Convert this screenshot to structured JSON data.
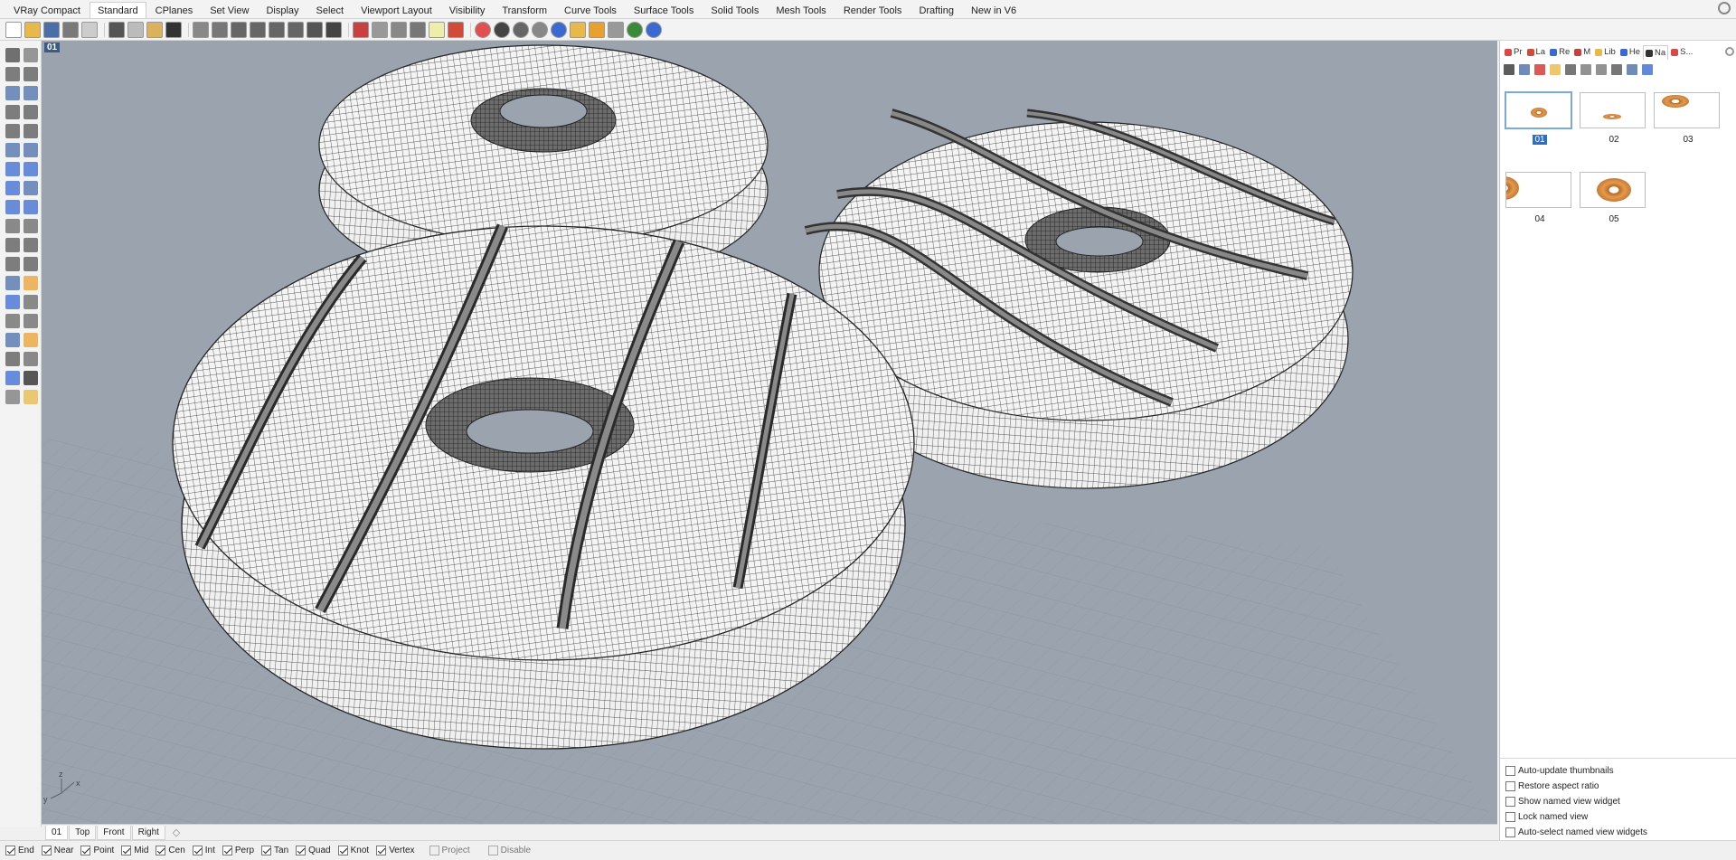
{
  "toolbar_tabs": [
    {
      "label": "VRay Compact",
      "active": false
    },
    {
      "label": "Standard",
      "active": true
    },
    {
      "label": "CPlanes",
      "active": false
    },
    {
      "label": "Set View",
      "active": false
    },
    {
      "label": "Display",
      "active": false
    },
    {
      "label": "Select",
      "active": false
    },
    {
      "label": "Viewport Layout",
      "active": false
    },
    {
      "label": "Visibility",
      "active": false
    },
    {
      "label": "Transform",
      "active": false
    },
    {
      "label": "Curve Tools",
      "active": false
    },
    {
      "label": "Surface Tools",
      "active": false
    },
    {
      "label": "Solid Tools",
      "active": false
    },
    {
      "label": "Mesh Tools",
      "active": false
    },
    {
      "label": "Render Tools",
      "active": false
    },
    {
      "label": "Drafting",
      "active": false
    },
    {
      "label": "New in V6",
      "active": false
    }
  ],
  "icon_toolbar": [
    {
      "name": "new-file-icon",
      "color": "#ffffff"
    },
    {
      "name": "open-folder-icon",
      "color": "#e8b84a"
    },
    {
      "name": "save-icon",
      "color": "#4a6ea8"
    },
    {
      "name": "print-icon",
      "color": "#7a7a7a"
    },
    {
      "name": "import-icon",
      "color": "#cccccc"
    },
    {
      "name": "cut-icon",
      "color": "#555555"
    },
    {
      "name": "copy-icon",
      "color": "#bbbbbb"
    },
    {
      "name": "paste-icon",
      "color": "#d9b25b"
    },
    {
      "name": "undo-icon",
      "color": "#333333"
    },
    {
      "name": "pan-icon",
      "color": "#888888"
    },
    {
      "name": "rotate-view-icon",
      "color": "#777777"
    },
    {
      "name": "zoom-icon",
      "color": "#666666"
    },
    {
      "name": "zoom-window-icon",
      "color": "#666666"
    },
    {
      "name": "zoom-extents-icon",
      "color": "#666666"
    },
    {
      "name": "zoom-selected-icon",
      "color": "#666666"
    },
    {
      "name": "undo-view-icon",
      "color": "#555555"
    },
    {
      "name": "grid-icon",
      "color": "#444444"
    },
    {
      "name": "cplane-icon",
      "color": "#c84040"
    },
    {
      "name": "select-filter-icon",
      "color": "#999999"
    },
    {
      "name": "point-icon",
      "color": "#888888"
    },
    {
      "name": "lock-icon",
      "color": "#777777"
    },
    {
      "name": "light-icon",
      "color": "#eeeeaa"
    },
    {
      "name": "layers-icon",
      "color": "#d24a3a"
    },
    {
      "name": "color-wheel-icon",
      "color": "#e05050"
    },
    {
      "name": "shaded-sphere-icon",
      "color": "#444444"
    },
    {
      "name": "rendered-sphere-icon",
      "color": "#666666"
    },
    {
      "name": "ghosted-sphere-icon",
      "color": "#888888"
    },
    {
      "name": "render-sphere-icon",
      "color": "#3a6ad0"
    },
    {
      "name": "light-bulb-icon",
      "color": "#e8b84a"
    },
    {
      "name": "gear-tools-icon",
      "color": "#e8a030"
    },
    {
      "name": "dimension-icon",
      "color": "#999999"
    },
    {
      "name": "web-icon",
      "color": "#3a8a3a"
    },
    {
      "name": "help-icon",
      "color": "#3a6ad0"
    }
  ],
  "viewport": {
    "title": "01",
    "background": "#9aa3ae",
    "axis_labels": {
      "x": "x",
      "y": "y",
      "z": "z"
    }
  },
  "viewport_tabs": [
    {
      "label": "01",
      "active": true
    },
    {
      "label": "Top",
      "active": false
    },
    {
      "label": "Front",
      "active": false
    },
    {
      "label": "Right",
      "active": false
    }
  ],
  "osnap": [
    {
      "label": "End",
      "checked": true,
      "enabled": true
    },
    {
      "label": "Near",
      "checked": true,
      "enabled": true
    },
    {
      "label": "Point",
      "checked": true,
      "enabled": true
    },
    {
      "label": "Mid",
      "checked": true,
      "enabled": true
    },
    {
      "label": "Cen",
      "checked": true,
      "enabled": true
    },
    {
      "label": "Int",
      "checked": true,
      "enabled": true
    },
    {
      "label": "Perp",
      "checked": true,
      "enabled": true
    },
    {
      "label": "Tan",
      "checked": true,
      "enabled": true
    },
    {
      "label": "Quad",
      "checked": true,
      "enabled": true
    },
    {
      "label": "Knot",
      "checked": true,
      "enabled": true
    },
    {
      "label": "Vertex",
      "checked": true,
      "enabled": true
    },
    {
      "label": "Project",
      "checked": false,
      "enabled": false
    },
    {
      "label": "Disable",
      "checked": false,
      "enabled": false
    }
  ],
  "panel_tabs": [
    {
      "label": "Pr",
      "icon": "properties-icon",
      "color": "#d84a4a"
    },
    {
      "label": "La",
      "icon": "layers-icon",
      "color": "#d24a3a"
    },
    {
      "label": "Re",
      "icon": "render-icon",
      "color": "#3a6ad0"
    },
    {
      "label": "M",
      "icon": "materials-icon",
      "color": "#c84040"
    },
    {
      "label": "Lib",
      "icon": "libraries-icon",
      "color": "#e8b84a"
    },
    {
      "label": "He",
      "icon": "help-panel-icon",
      "color": "#3a6ad0"
    },
    {
      "label": "Na",
      "icon": "named-views-icon",
      "color": "#333333",
      "active": true
    },
    {
      "label": "S...",
      "icon": "sun-icon",
      "color": "#d84a4a"
    }
  ],
  "panel_tools": [
    {
      "name": "save-view-icon",
      "color": "#333333"
    },
    {
      "name": "edit-view-icon",
      "color": "#4a6ea8"
    },
    {
      "name": "delete-view-icon",
      "color": "#d23030"
    },
    {
      "name": "import-views-icon",
      "color": "#e8b84a"
    },
    {
      "name": "restore-icon",
      "color": "#555555"
    },
    {
      "name": "arrow-view-icon",
      "color": "#777777"
    },
    {
      "name": "copy-view-icon",
      "color": "#777777"
    },
    {
      "name": "show-widget-icon",
      "color": "#555555"
    },
    {
      "name": "large-thumbs-icon",
      "color": "#4a6ea8"
    },
    {
      "name": "panel-help-icon",
      "color": "#3a6ad0"
    }
  ],
  "named_views": [
    {
      "label": "01",
      "selected": true
    },
    {
      "label": "02",
      "selected": false
    },
    {
      "label": "03",
      "selected": false
    },
    {
      "label": "04",
      "selected": false
    },
    {
      "label": "05",
      "selected": false
    }
  ],
  "panel_options": [
    {
      "label": "Auto-update thumbnails",
      "checked": false
    },
    {
      "label": "Restore aspect ratio",
      "checked": false
    },
    {
      "label": "Show named view widget",
      "checked": false
    },
    {
      "label": "Lock named view",
      "checked": false
    },
    {
      "label": "Auto-select named view widgets",
      "checked": false
    }
  ]
}
